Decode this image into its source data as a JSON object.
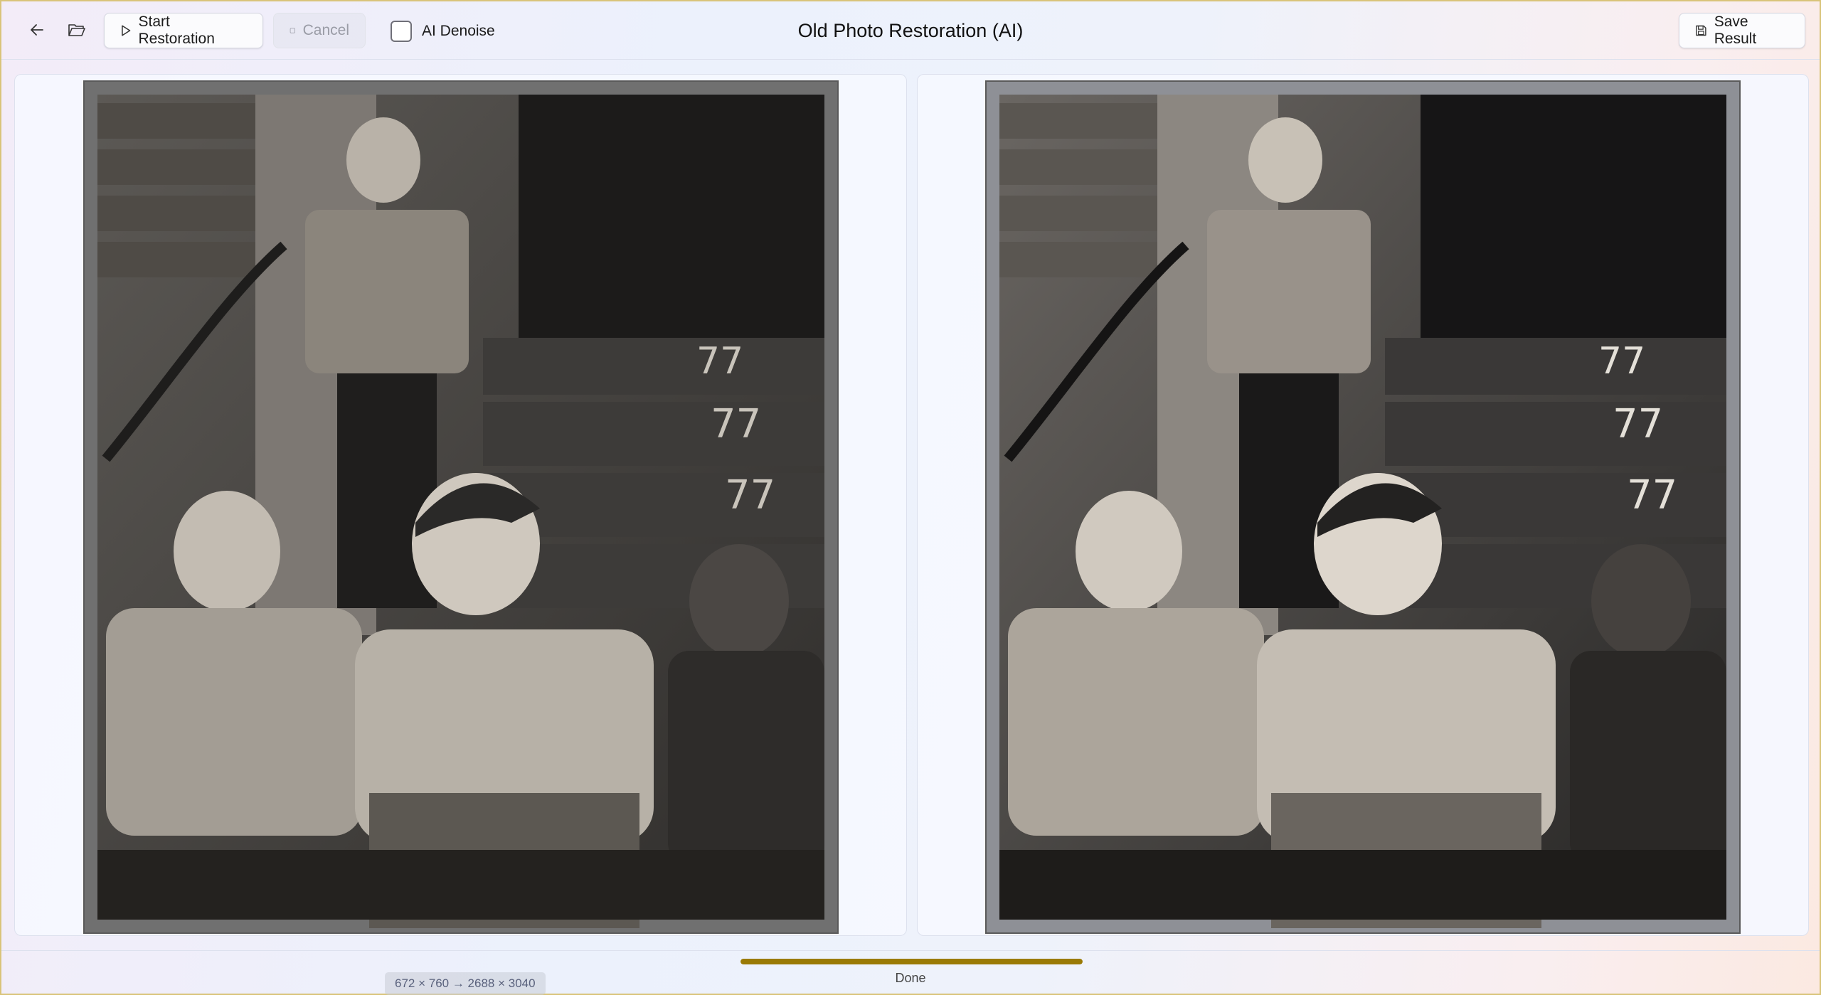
{
  "window": {
    "title": "Old Photo Restoration (AI)"
  },
  "toolbar": {
    "back_icon": "back-arrow-icon",
    "open_icon": "folder-open-icon",
    "start_label": "Start Restoration",
    "start_icon": "play-icon",
    "cancel_label": "Cancel",
    "cancel_icon": "stop-icon",
    "cancel_enabled": false,
    "denoise_label": "AI Denoise",
    "denoise_checked": false,
    "save_label": "Save Result",
    "save_icon": "save-disk-icon"
  },
  "panels": {
    "original": {
      "dimension_label": "672 × 760 → 2688 × 3040",
      "image": "original-photo"
    },
    "restored": {
      "image": "restored-photo"
    }
  },
  "status": {
    "progress_percent": 100,
    "text": "Done"
  },
  "colors": {
    "progress": "#9a7a05",
    "window_border": "#d9c47a"
  }
}
